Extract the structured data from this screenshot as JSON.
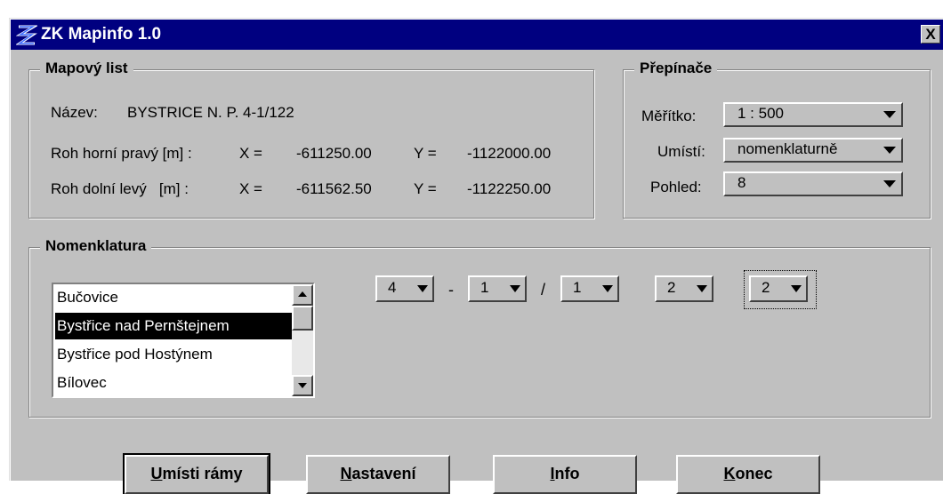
{
  "window": {
    "title": "ZK Mapinfo 1.0",
    "close_label": "X"
  },
  "mapovy_list": {
    "title": "Mapový list",
    "nazev_label": "Název:",
    "nazev_value": "BYSTRICE N. P. 4-1/122",
    "rows": [
      {
        "label": "Roh horní pravý [m] :",
        "x_label": "X =",
        "x_value": "-611250.00",
        "y_label": "Y =",
        "y_value": "-1122000.00"
      },
      {
        "label": "Roh dolní levý   [m] :",
        "x_label": "X =",
        "x_value": "-611562.50",
        "y_label": "Y =",
        "y_value": "-1122250.00"
      }
    ]
  },
  "prepinace": {
    "title": "Přepínače",
    "meritko_label": "Měřítko:",
    "meritko_value": "1 : 500",
    "umisti_label": "Umístí:",
    "umisti_value": "nomenklaturně",
    "pohled_label": "Pohled:",
    "pohled_value": "8"
  },
  "nomenklatura": {
    "title": "Nomenklatura",
    "list_items": [
      "Bučovice",
      "Bystřice nad Pernštejnem",
      "Bystřice pod Hostýnem",
      "Bílovec"
    ],
    "selected_index": 1,
    "selectors": [
      "4",
      "1",
      "1",
      "2",
      "2"
    ],
    "separators": [
      "-",
      "/"
    ]
  },
  "buttons": {
    "umisti_ramy": {
      "underline": "U",
      "rest": "místi rámy"
    },
    "nastaveni": {
      "underline": "N",
      "rest": "astavení"
    },
    "info": {
      "underline": "I",
      "rest": "nfo"
    },
    "konec": {
      "underline": "K",
      "rest": "onec"
    }
  }
}
